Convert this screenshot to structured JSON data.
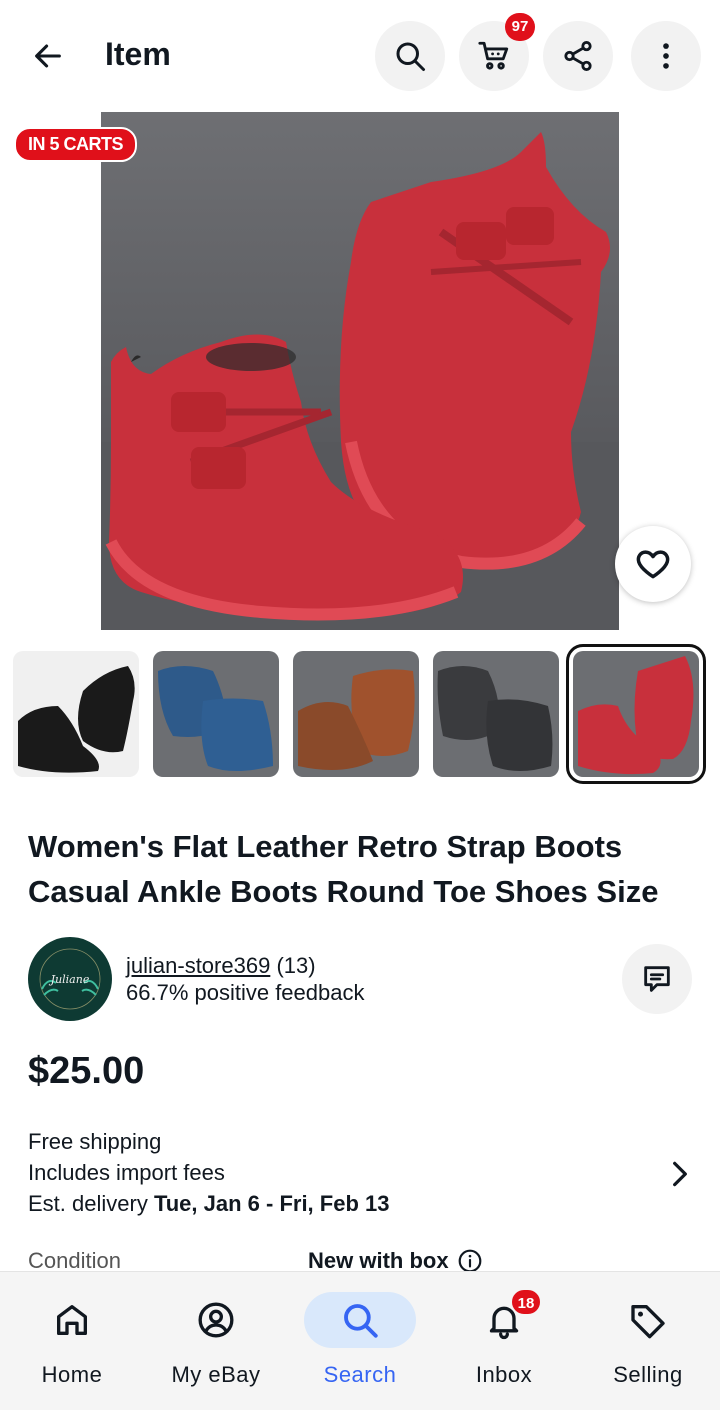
{
  "header": {
    "title": "Item",
    "cart_count": "97",
    "icons": [
      "back-arrow-icon",
      "search-icon",
      "cart-icon",
      "share-icon",
      "more-vertical-icon"
    ]
  },
  "gallery": {
    "carts_badge": "IN 5 CARTS",
    "thumbnails": [
      {
        "color_name": "black",
        "color": "#1a1a1a"
      },
      {
        "color_name": "blue",
        "color": "#2e5a8a"
      },
      {
        "color_name": "brown",
        "color": "#8a4a2a"
      },
      {
        "color_name": "gray",
        "color": "#3a3b3e"
      },
      {
        "color_name": "red",
        "color": "#c8303c",
        "selected": true
      }
    ]
  },
  "item": {
    "title": "Women's Flat Leather Retro Strap Boots Casual Ankle Boots Round Toe Shoes Size"
  },
  "seller": {
    "avatar_text": "Juliane",
    "name": "julian-store369",
    "rating_count": "(13)",
    "feedback": "66.7% positive feedback"
  },
  "price": "$25.00",
  "shipping": {
    "line1": "Free shipping",
    "line2": "Includes import fees",
    "delivery_prefix": "Est. delivery ",
    "delivery_dates": "Tue, Jan 6 - Fri, Feb 13"
  },
  "condition": {
    "label": "Condition",
    "value": "New with box"
  },
  "nav": {
    "items": [
      {
        "label": "Home"
      },
      {
        "label": "My eBay"
      },
      {
        "label": "Search",
        "active": true
      },
      {
        "label": "Inbox",
        "badge": "18"
      },
      {
        "label": "Selling"
      }
    ]
  },
  "colors": {
    "accent_blue": "#3665f3",
    "badge_red": "#e0101a",
    "boot_red": "#c8303c"
  }
}
